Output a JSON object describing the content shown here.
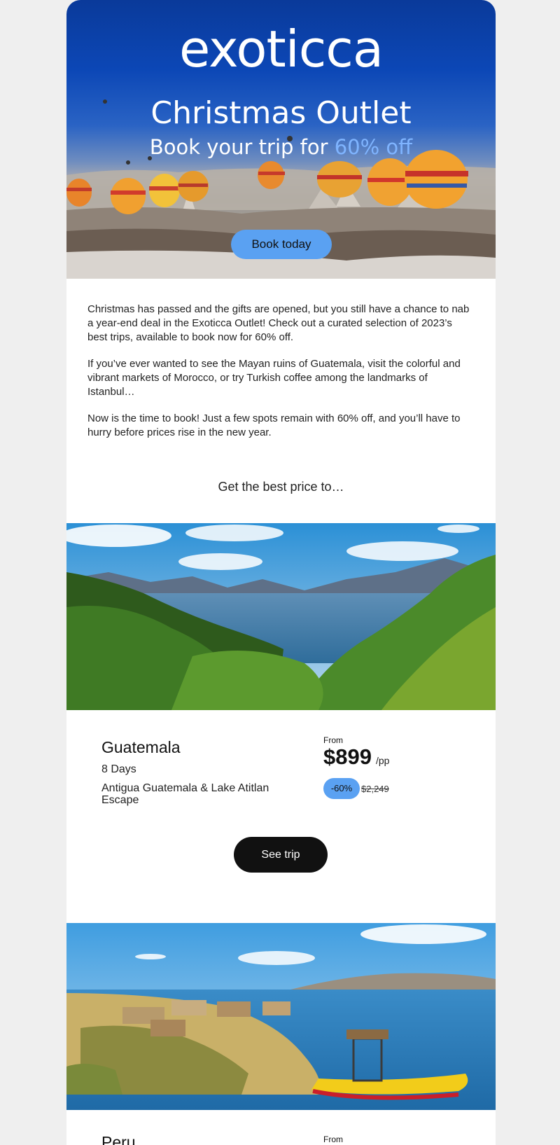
{
  "brand": {
    "logo_text": "exoticca"
  },
  "hero": {
    "title": "Christmas Outlet",
    "subtitle_prefix": "Book your trip for ",
    "subtitle_accent": "60% off",
    "cta_label": "Book today",
    "accent_color": "#7fb4ff",
    "button_color": "#5aa1f2"
  },
  "intro": {
    "paragraphs": [
      "Christmas has passed and the gifts are opened, but you still have a chance to nab a year-end deal in the Exoticca Outlet! Check out a curated selection of 2023’s best trips, available to book now for 60% off.",
      "If you’ve ever wanted to see the Mayan ruins of Guatemala, visit the colorful and vibrant markets of Morocco, or try Turkish coffee among the landmarks of Istanbul…",
      "Now is the time to book! Just a few spots remain with 60% off, and you’ll have to hurry before prices rise in the new year."
    ]
  },
  "section_heading": "Get the best price to…",
  "trips": [
    {
      "name": "Guatemala",
      "days": "8 Days",
      "route": "Antigua Guatemala & Lake Atitlan Escape",
      "from_label": "From",
      "price": "$899",
      "per": "/pp",
      "discount": "-60%",
      "old_price": "$2,249",
      "cta_label": "See trip"
    },
    {
      "name": "Peru",
      "from_label": "From"
    }
  ]
}
